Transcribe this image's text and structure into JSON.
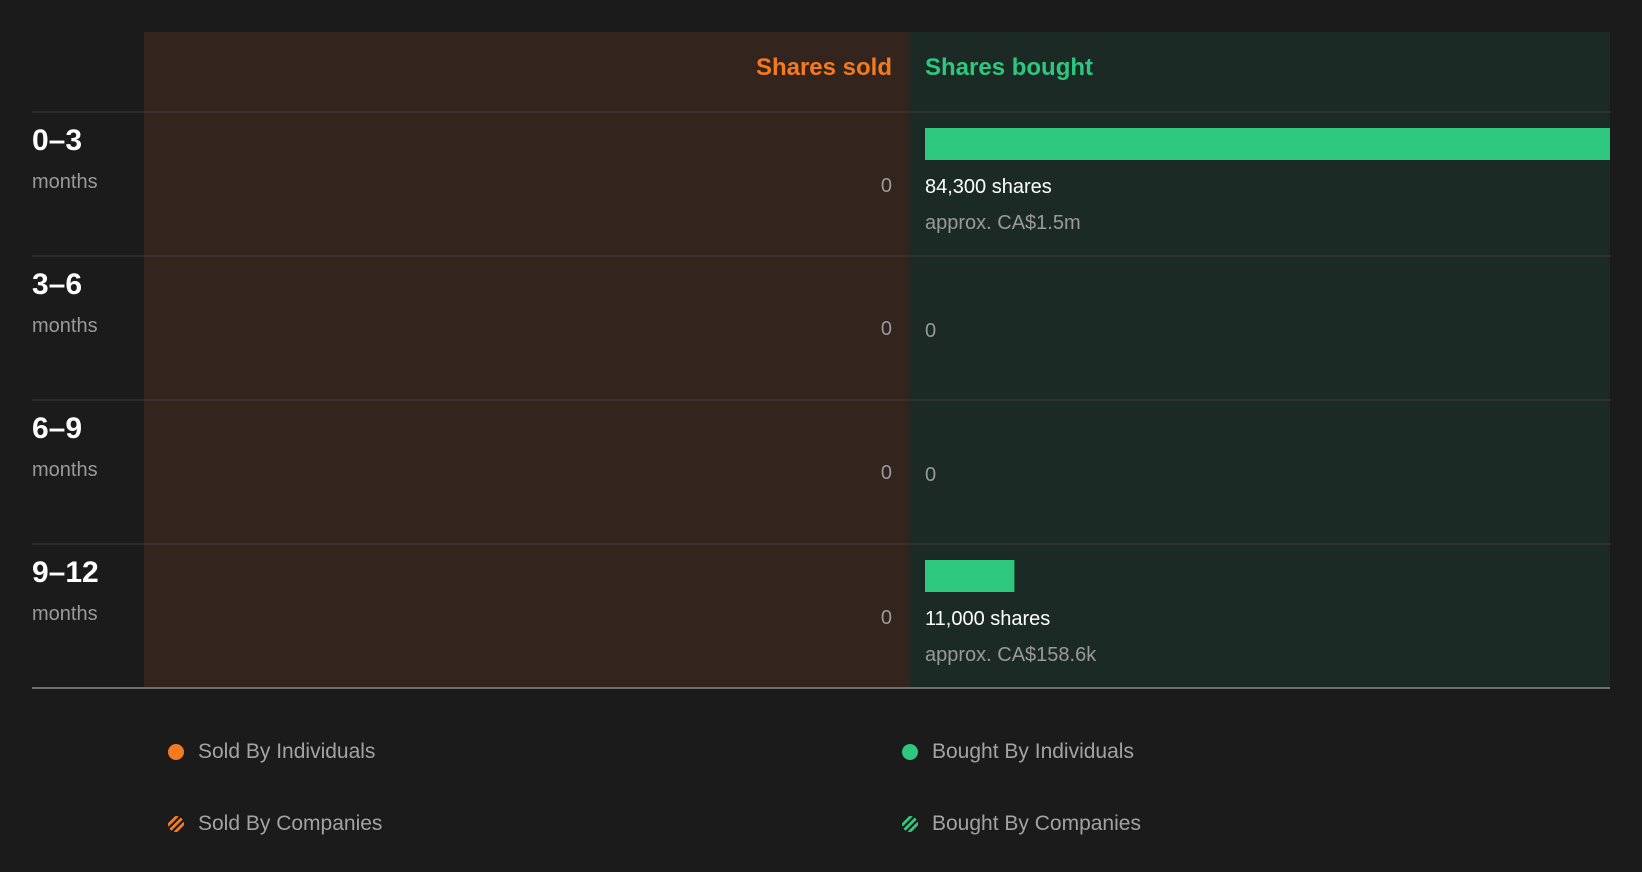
{
  "colors": {
    "sold": "#f47a20",
    "bought": "#2ec77e",
    "sold_bg": "#33241d",
    "bought_bg": "#1c2a25",
    "page_bg": "#1b1b1b"
  },
  "headers": {
    "sold": "Shares sold",
    "bought": "Shares bought"
  },
  "chart_data": {
    "type": "bar",
    "categories": [
      "0–3",
      "3–6",
      "6–9",
      "9–12"
    ],
    "category_unit": "months",
    "series": [
      {
        "name": "Shares sold",
        "values": [
          0,
          0,
          0,
          0
        ]
      },
      {
        "name": "Shares bought",
        "values": [
          84300,
          0,
          0,
          11000
        ]
      }
    ],
    "rows": [
      {
        "range": "0–3",
        "unit": "months",
        "sold": "0",
        "bought": "84,300 shares",
        "approx": "approx. CA$1.5m"
      },
      {
        "range": "3–6",
        "unit": "months",
        "sold": "0",
        "bought": "0",
        "approx": ""
      },
      {
        "range": "6–9",
        "unit": "months",
        "sold": "0",
        "bought": "0",
        "approx": ""
      },
      {
        "range": "9–12",
        "unit": "months",
        "sold": "0",
        "bought": "11,000 shares",
        "approx": "approx. CA$158.6k"
      }
    ],
    "legend": [
      {
        "label": "Sold By Individuals",
        "style": "solid",
        "color": "#f47a20"
      },
      {
        "label": "Bought By Individuals",
        "style": "solid",
        "color": "#2ec77e"
      },
      {
        "label": "Sold By Companies",
        "style": "striped",
        "color": "#f47a20"
      },
      {
        "label": "Bought By Companies",
        "style": "striped",
        "color": "#2ec77e"
      }
    ]
  }
}
